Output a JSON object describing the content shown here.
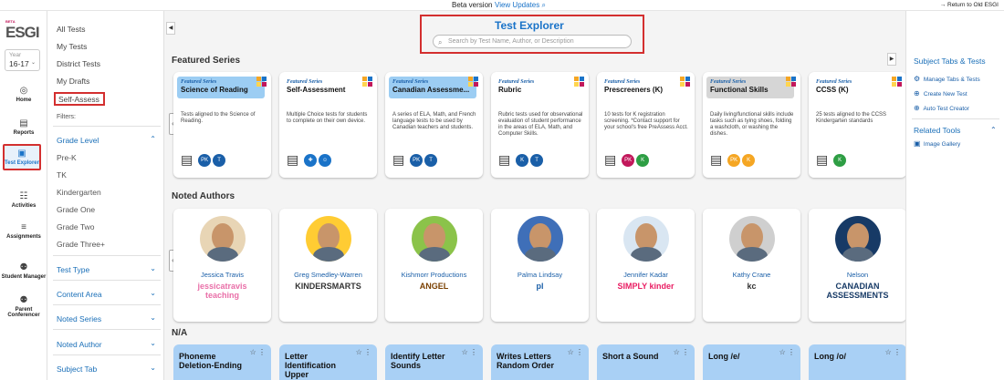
{
  "topbar": {
    "beta": "Beta version",
    "updates": "View Updates ⌕",
    "return": "→  Return to Old ESGI"
  },
  "nav": {
    "logo": "ESGI",
    "logo_tag": "BETA",
    "year_label": "Year",
    "year_value": "16-17",
    "items": [
      {
        "label": "Home",
        "icon": "◎"
      },
      {
        "label": "Reports",
        "icon": "▤"
      },
      {
        "label": "Test Explorer",
        "icon": "▣"
      },
      {
        "label": "Activities",
        "icon": "☷"
      },
      {
        "label": "Assignments",
        "icon": "≡"
      },
      {
        "label": "Student Manager",
        "icon": "⚉"
      },
      {
        "label": "Parent Conferencer",
        "icon": "⚉"
      }
    ]
  },
  "sidebar": {
    "links": [
      "All Tests",
      "My Tests",
      "District Tests",
      "My Drafts"
    ],
    "self_assess": "Self-Assess",
    "filters_label": "Filters:",
    "grade_level": "Grade Level",
    "grades": [
      "Pre-K",
      "TK",
      "Kindergarten",
      "Grade One",
      "Grade Two",
      "Grade Three+"
    ],
    "filter_sections": [
      "Test Type",
      "Content Area",
      "Noted Series",
      "Noted Author",
      "Subject Tab"
    ]
  },
  "main": {
    "title": "Test Explorer",
    "search_placeholder": "Search by Test Name, Author, or Description",
    "featured_title": "Featured Series",
    "featured_tag": "Featured Series",
    "featured": [
      {
        "name": "Science of Reading",
        "desc": "Tests aligned to the Science of Reading.",
        "color": "#9ccdf3",
        "badges": [
          "PK",
          "T"
        ],
        "badge_colors": [
          "#1a5fa8",
          "#1a5fa8"
        ]
      },
      {
        "name": "Self-Assessment",
        "desc": "Multiple Choice tests for students to complete on their own device.",
        "color": "#ffffff",
        "badges": [
          "✚",
          "☺"
        ],
        "badge_colors": [
          "#1a73c8",
          "#1a73c8"
        ]
      },
      {
        "name": "Canadian Assessme...",
        "desc": "A series of ELA, Math, and French language tests to be used by Canadian teachers and students.",
        "color": "#9ccdf3",
        "badges": [
          "PK",
          "T"
        ],
        "badge_colors": [
          "#1a5fa8",
          "#1a5fa8"
        ]
      },
      {
        "name": "Rubric",
        "desc": "Rubric tests used for observational evaluation of student performance in the areas of ELA, Math, and Computer Skills.",
        "color": "#ffffff",
        "badges": [
          "K",
          "T"
        ],
        "badge_colors": [
          "#1a5fa8",
          "#1a5fa8"
        ]
      },
      {
        "name": "Prescreeners (K)",
        "desc": "10 tests for K registration screening. *Contact support for your school's free PreAssess Acct.",
        "color": "#ffffff",
        "badges": [
          "PK",
          "K"
        ],
        "badge_colors": [
          "#c2185b",
          "#2e9e44"
        ]
      },
      {
        "name": "Functional Skills",
        "desc": "Daily living/functional skills include tasks such as tying shoes, folding a washcloth, or washing the dishes.",
        "color": "#d6d6d6",
        "badges": [
          "PK",
          "K"
        ],
        "badge_colors": [
          "#f5a623",
          "#f5a623"
        ]
      },
      {
        "name": "CCSS (K)",
        "desc": "25 tests aligned to the CCSS Kindergarten standards",
        "color": "#ffffff",
        "badges": [
          "K"
        ],
        "badge_colors": [
          "#2e9e44"
        ]
      }
    ],
    "authors_title": "Noted Authors",
    "authors": [
      {
        "name": "Jessica Travis",
        "brand": "jessicatravis teaching",
        "bg": "#e8d5b5",
        "brand_color": "#e96fa8"
      },
      {
        "name": "Greg Smedley-Warren",
        "brand": "KINDERSMARTS",
        "bg": "#ffcc33",
        "brand_color": "#333"
      },
      {
        "name": "Kishmorr Productions",
        "brand": "ANGEL",
        "bg": "#8bc34a",
        "brand_color": "#7a3f00"
      },
      {
        "name": "Palma Lindsay",
        "brand": "pl",
        "bg": "#3f6fb8",
        "brand_color": "#1a5fa8"
      },
      {
        "name": "Jennifer Kadar",
        "brand": "SIMPLY kinder",
        "bg": "#d9e6f2",
        "brand_color": "#e91e63"
      },
      {
        "name": "Kathy Crane",
        "brand": "kc",
        "bg": "#cfcfcf",
        "brand_color": "#333"
      },
      {
        "name": "Nelson",
        "brand": "CANADIAN ASSESSMENTS",
        "bg": "#173a66",
        "brand_color": "#173a66"
      }
    ],
    "na_title": "N/A",
    "na_tests": [
      "Phoneme Deletion-Ending",
      "Letter Identification Upper",
      "Identify Letter Sounds",
      "Writes Letters Random Order",
      "Short a Sound",
      "Long /e/",
      "Long /o/"
    ]
  },
  "rightpanel": {
    "subject_tabs": "Subject Tabs & Tests",
    "items": [
      {
        "label": "Manage Tabs & Tests",
        "icon": "⚙"
      },
      {
        "label": "Create New Test",
        "icon": "⊕"
      },
      {
        "label": "Auto Test Creator",
        "icon": "⊕"
      }
    ],
    "related_tools": "Related Tools",
    "tools": [
      {
        "label": "Image Gallery",
        "icon": "▣"
      }
    ]
  }
}
